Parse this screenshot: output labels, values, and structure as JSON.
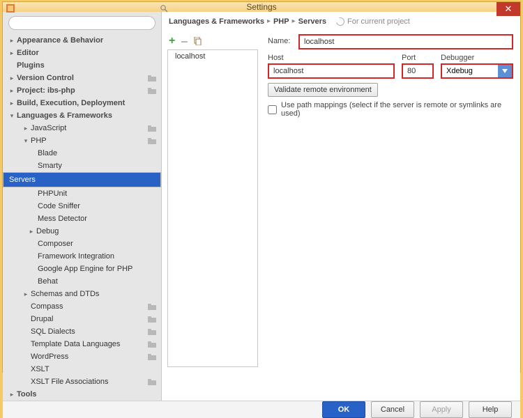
{
  "window": {
    "title": "Settings",
    "close": "✕"
  },
  "search": {
    "placeholder": ""
  },
  "tree": {
    "appearance": "Appearance & Behavior",
    "editor": "Editor",
    "plugins": "Plugins",
    "version_control": "Version Control",
    "project": "Project: ibs-php",
    "build": "Build, Execution, Deployment",
    "langfw": "Languages & Frameworks",
    "javascript": "JavaScript",
    "php": "PHP",
    "blade": "Blade",
    "smarty": "Smarty",
    "servers": "Servers",
    "phpunit": "PHPUnit",
    "code_sniffer": "Code Sniffer",
    "mess_detector": "Mess Detector",
    "debug": "Debug",
    "composer": "Composer",
    "framework_integration": "Framework Integration",
    "gae": "Google App Engine for PHP",
    "behat": "Behat",
    "schemas": "Schemas and DTDs",
    "compass": "Compass",
    "drupal": "Drupal",
    "sql_dialects": "SQL Dialects",
    "template_langs": "Template Data Languages",
    "wordpress": "WordPress",
    "xslt": "XSLT",
    "xslt_assoc": "XSLT File Associations",
    "tools": "Tools"
  },
  "breadcrumb": {
    "a": "Languages & Frameworks",
    "b": "PHP",
    "c": "Servers",
    "hint": "For current project"
  },
  "list": {
    "items": [
      "localhost"
    ]
  },
  "form": {
    "name_label": "Name:",
    "name_value": "localhost",
    "host_label": "Host",
    "host_value": "localhost",
    "port_label": "Port",
    "port_value": "80",
    "debugger_label": "Debugger",
    "debugger_value": "Xdebug",
    "validate": "Validate remote environment",
    "use_path": "Use path mappings (select if the server is remote or symlinks are used)"
  },
  "footer": {
    "ok": "OK",
    "cancel": "Cancel",
    "apply": "Apply",
    "help": "Help"
  }
}
